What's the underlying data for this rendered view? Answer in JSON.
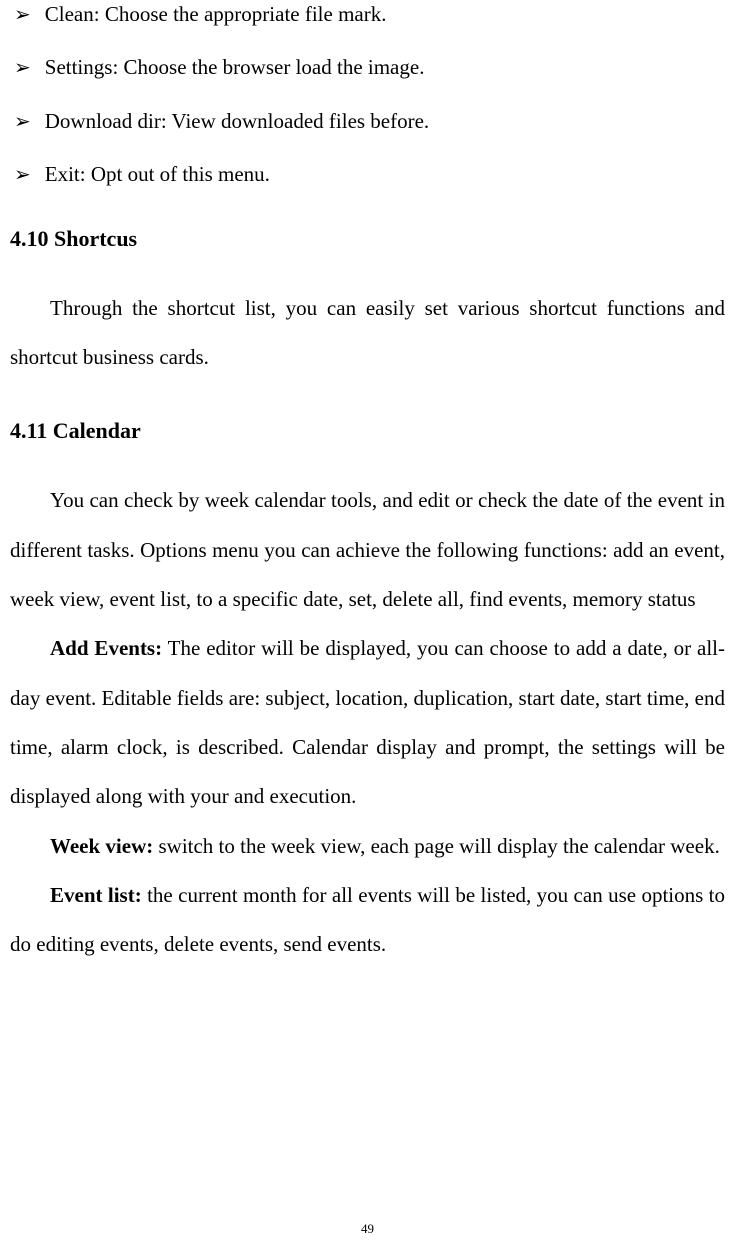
{
  "bullets": [
    {
      "marker": "➢",
      "text": "Clean: Choose the appropriate file mark."
    },
    {
      "marker": "➢",
      "text": "Settings: Choose the browser load the image."
    },
    {
      "marker": "➢",
      "text": "Download dir: View downloaded files before."
    },
    {
      "marker": "➢",
      "text": "Exit: Opt out of this menu."
    }
  ],
  "section410": {
    "heading": "4.10 Shortcus",
    "paragraph": "Through the shortcut list, you can easily set various shortcut functions and shortcut business cards."
  },
  "section411": {
    "heading": "4.11 Calendar",
    "paragraph1": "You can check by week calendar tools, and edit or check the date of the event in different tasks. Options menu you can achieve the following functions: add an event, week view, event list, to a specific date, set, delete all, find events, memory status",
    "addEvents": {
      "label": "Add Events:",
      "text": " The editor will be displayed, you can choose to add a date, or all-day event. Editable fields are: subject, location, duplication, start date, start time, end time, alarm clock, is described. Calendar display and prompt, the settings will be displayed along with your and execution."
    },
    "weekView": {
      "label": "Week view:",
      "text": " switch to the week view, each page will display the calendar week."
    },
    "eventList": {
      "label": "Event list:",
      "text": " the current month for all events will be listed, you can use options to do editing events, delete events, send events."
    }
  },
  "pageNumber": "49"
}
